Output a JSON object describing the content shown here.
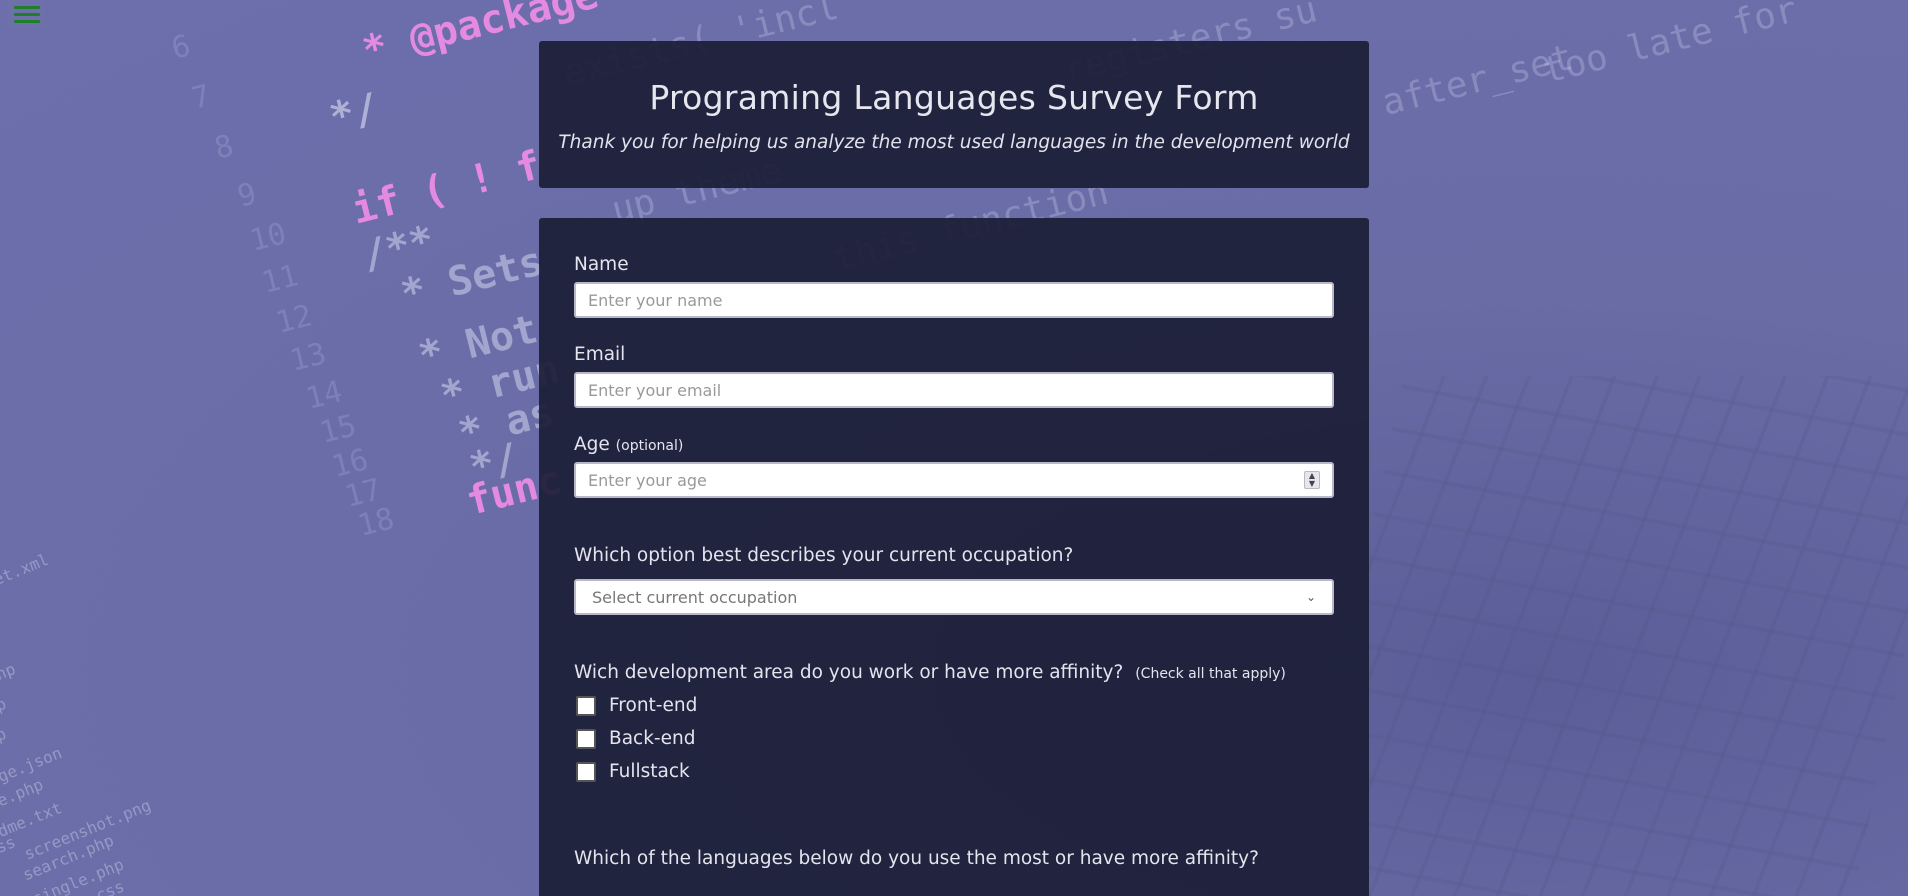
{
  "header": {
    "title": "Programing Languages Survey Form",
    "description": "Thank you for helping us analyze the most used languages in the development world"
  },
  "form": {
    "name": {
      "label": "Name",
      "placeholder": "Enter your name"
    },
    "email": {
      "label": "Email",
      "placeholder": "Enter your email"
    },
    "age": {
      "label": "Age",
      "note": "(optional)",
      "placeholder": "Enter your age"
    },
    "occupation": {
      "question": "Which option best describes your current occupation?",
      "selected": "Select current occupation"
    },
    "area": {
      "question": "Wich development area do you work or have more affinity?",
      "note": "(Check all that apply)",
      "options": [
        "Front-end",
        "Back-end",
        "Fullstack"
      ]
    },
    "languages": {
      "question": "Which of the languages below do you use the most or have more affinity?"
    }
  },
  "background": {
    "code_lines": [
      "* @package",
      "*/",
      "if ( ! f",
      "/**",
      "* Sets",
      "* Not",
      "* run",
      "* as",
      "*/",
      "func",
      "exists( 'incl",
      "up theme",
      "this function",
      "registers su",
      "after_set",
      "too late for"
    ],
    "line_numbers": [
      "6",
      "7",
      "8",
      "9",
      "10",
      "11",
      "12",
      "13",
      "14",
      "15",
      "16",
      "17",
      "18"
    ],
    "side_files": [
      "et.xml",
      "np",
      "p",
      "p",
      "ge.json",
      "e.php",
      "dme.txt",
      "ss",
      "screenshot.png",
      "search.php",
      "single.php",
      "style.css"
    ]
  },
  "colors": {
    "background": "#6d6fad",
    "card": "#1c1e37",
    "menu_icon": "#1f7d2c",
    "keyword_pink": "#e48ae0",
    "keyword_blue": "#7fb6ff"
  },
  "icons": {
    "menu": "hamburger-menu-icon",
    "select": "chevron-down-icon",
    "spinner": "number-spinner-icon"
  }
}
